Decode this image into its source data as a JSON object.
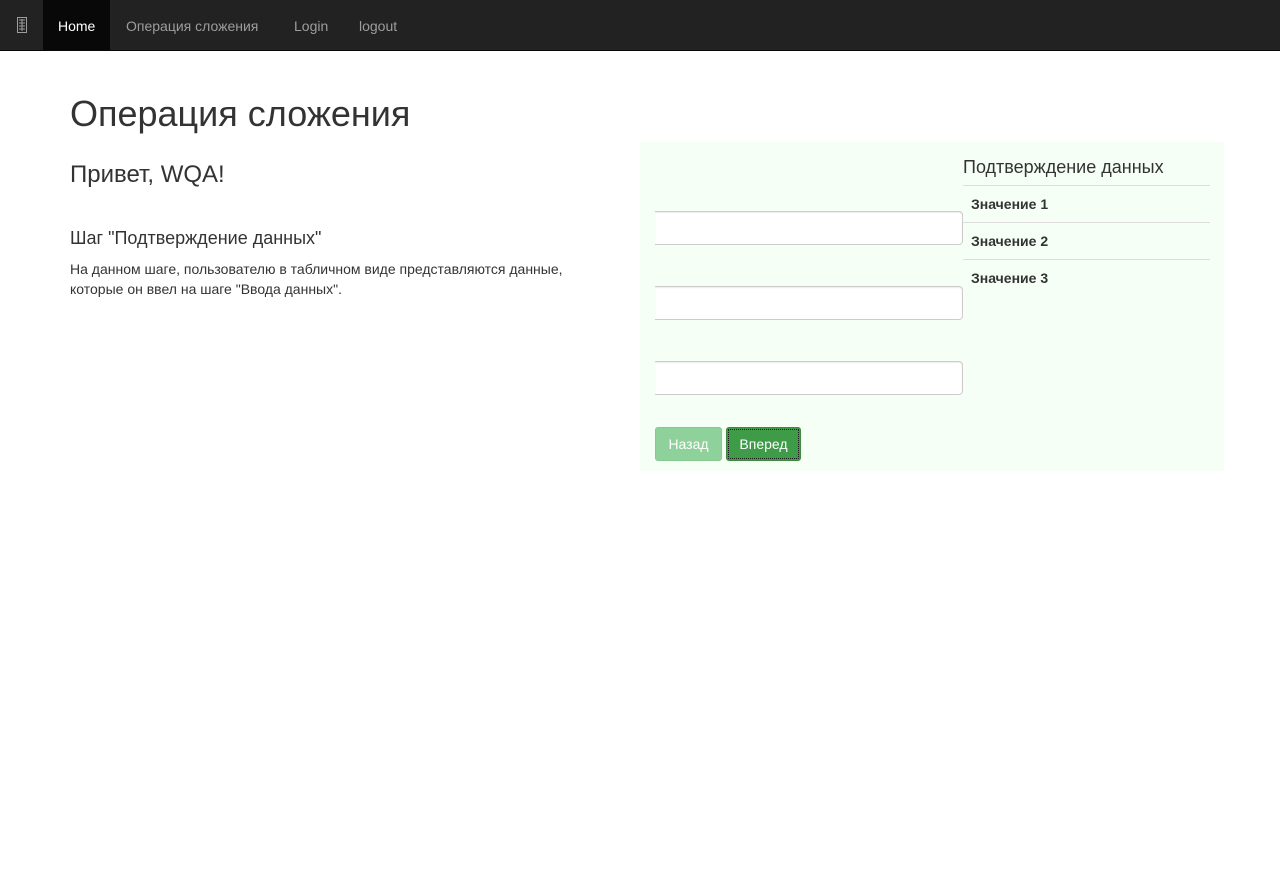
{
  "navbar": {
    "brand_icon": "grid-icon",
    "items": [
      {
        "label": "Home",
        "active": true
      },
      {
        "label": "Операция сложения",
        "active": false
      },
      {
        "label": "Login",
        "active": false
      },
      {
        "label": "logout",
        "active": false
      }
    ]
  },
  "main": {
    "title": "Операция сложения",
    "greeting": "Привет, WQA!",
    "step_title": "Шаг \"Подтверждение данных\"",
    "step_description": "На данном шаге, пользователю в табличном виде представляются данные, которые он ввел на шаге \"Ввода данных\"."
  },
  "panel": {
    "fields": [
      {
        "value": "",
        "placeholder": ""
      },
      {
        "value": "",
        "placeholder": ""
      },
      {
        "value": "",
        "placeholder": ""
      }
    ],
    "back_label": "Назад",
    "next_label": "Вперед",
    "confirm_title": "Подтверждение данных",
    "confirm_rows": [
      {
        "label": "Значение 1"
      },
      {
        "label": "Значение 2"
      },
      {
        "label": "Значение 3"
      }
    ]
  },
  "colors": {
    "navbar_bg": "#222222",
    "nav_active_bg": "#080808",
    "panel_bg": "#f6fff6",
    "button_primary": "#3e9c48",
    "button_disabled": "#8fd19a"
  }
}
